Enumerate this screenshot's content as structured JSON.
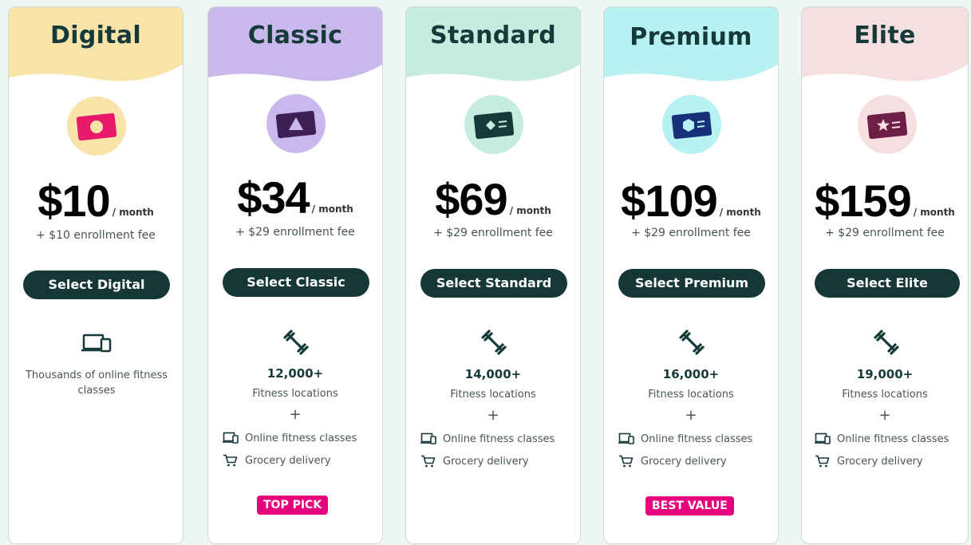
{
  "plans": [
    {
      "name": "Digital",
      "price": "$10",
      "period": "/ month",
      "fee": "+ $10 enrollment fee",
      "button": "Select Digital",
      "online_text": "Thousands of online fitness classes",
      "header_color": "#f8e4a8",
      "icon_bg": "#f8e4a8",
      "icon_color": "#e6196b"
    },
    {
      "name": "Classic",
      "price": "$34",
      "period": "/ month",
      "fee": "+ $29 enrollment fee",
      "button": "Select Classic",
      "locations_count": "12,000+",
      "locations_label": "Fitness locations",
      "plus": "+",
      "feature_online": "Online fitness classes",
      "feature_grocery": "Grocery delivery",
      "badge": "TOP PICK",
      "header_color": "#c8b8ec",
      "icon_bg": "#c8b8ec",
      "icon_color": "#3d1f55"
    },
    {
      "name": "Standard",
      "price": "$69",
      "period": "/ month",
      "fee": "+ $29 enrollment fee",
      "button": "Select Standard",
      "locations_count": "14,000+",
      "locations_label": "Fitness locations",
      "plus": "+",
      "feature_online": "Online fitness classes",
      "feature_grocery": "Grocery delivery",
      "header_color": "#c6ebdf",
      "icon_bg": "#c6ebdf",
      "icon_color": "#163a3a"
    },
    {
      "name": "Premium",
      "price": "$109",
      "period": "/ month",
      "fee": "+ $29 enrollment fee",
      "button": "Select Premium",
      "locations_count": "16,000+",
      "locations_label": "Fitness locations",
      "plus": "+",
      "feature_online": "Online fitness classes",
      "feature_grocery": "Grocery delivery",
      "badge": "BEST VALUE",
      "header_color": "#b8f1f1",
      "icon_bg": "#b8f1f1",
      "icon_color": "#17307a"
    },
    {
      "name": "Elite",
      "price": "$159",
      "period": "/ month",
      "fee": "+ $29 enrollment fee",
      "button": "Select Elite",
      "locations_count": "19,000+",
      "locations_label": "Fitness locations",
      "plus": "+",
      "feature_online": "Online fitness classes",
      "feature_grocery": "Grocery delivery",
      "header_color": "#f6dfe0",
      "icon_bg": "#f6dfe0",
      "icon_color": "#6e1f47"
    }
  ],
  "colors": {
    "button_bg": "#153836",
    "badge_bg": "#e6007e",
    "title_text": "#163a3a"
  }
}
